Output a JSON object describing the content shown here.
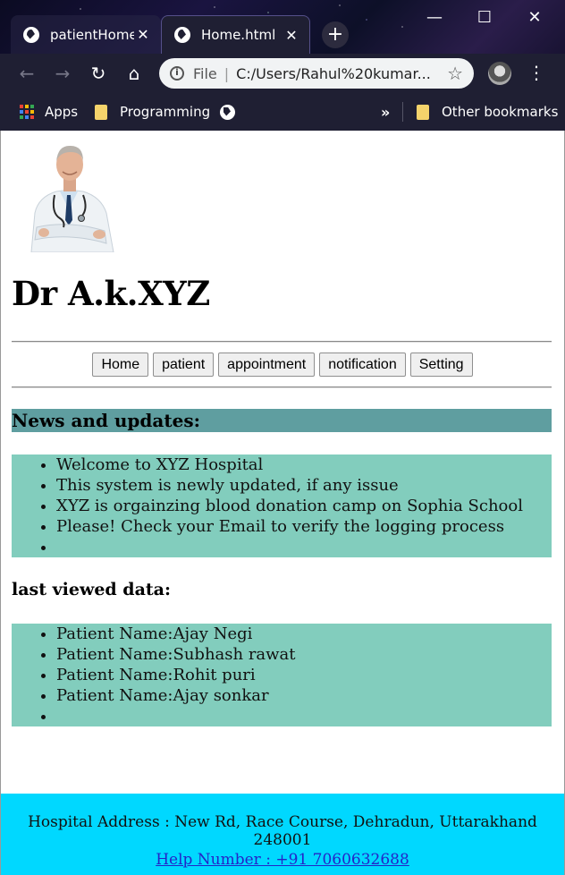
{
  "browser": {
    "tabs": [
      {
        "label": "patientHome",
        "active": false
      },
      {
        "label": "Home.html",
        "active": true
      }
    ],
    "new_tab_label": "+",
    "window_controls": {
      "minimize": "—",
      "maximize": "☐",
      "close": "✕"
    },
    "address": {
      "scheme_label": "File",
      "separator": "|",
      "url": "C:/Users/Rahul%20kumar..."
    },
    "bookmarks": {
      "apps": "Apps",
      "programming": "Programming",
      "overflow": "»",
      "other": "Other bookmarks"
    },
    "icons": {
      "back": "arrow-left-icon",
      "forward": "arrow-right-icon",
      "reload": "reload-icon",
      "home": "home-icon",
      "star": "star-icon",
      "menu": "kebab-menu-icon"
    }
  },
  "page": {
    "title": "Dr A.k.XYZ",
    "nav": [
      "Home",
      "patient",
      "appointment",
      "notification",
      "Setting"
    ],
    "news_heading": "News and updates:",
    "news_items": [
      "Welcome to XYZ Hospital",
      "This system is newly updated, if any issue",
      "XYZ is orgainzing blood donation camp on Sophia School",
      "Please! Check your Email to verify the logging process",
      ""
    ],
    "last_viewed_heading": "last viewed data:",
    "last_viewed_items": [
      "Patient Name:Ajay Negi",
      "Patient Name:Subhash rawat",
      "Patient Name:Rohit puri",
      "Patient Name:Ajay sonkar",
      ""
    ],
    "footer": {
      "address": "Hospital Address : New Rd, Race Course, Dehradun, Uttarakhand 248001",
      "help": "Help Number : +91 7060632688"
    },
    "colors": {
      "news_heading_bg": "#5f9ea0",
      "list_bg": "#82cdbd",
      "footer_bg": "#00d8ff",
      "link": "#2424c8"
    }
  }
}
